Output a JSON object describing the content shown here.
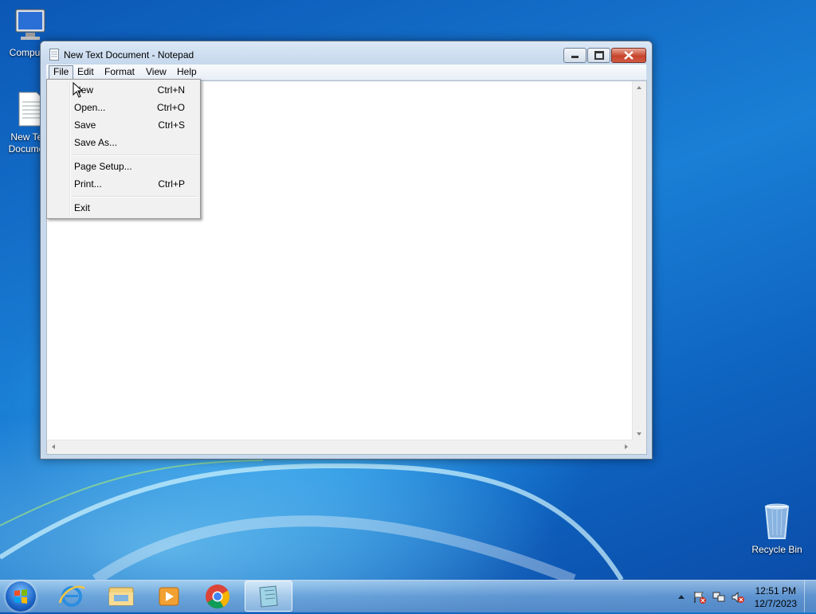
{
  "desktop": {
    "icons": [
      {
        "label": "Computer"
      },
      {
        "label": "New Text Document"
      },
      {
        "label": "Recycle Bin"
      }
    ]
  },
  "window": {
    "title": "New Text Document - Notepad",
    "menu": [
      "File",
      "Edit",
      "Format",
      "View",
      "Help"
    ],
    "active_menu": "File",
    "editor_text": ""
  },
  "file_menu": {
    "items": [
      {
        "label": "New",
        "shortcut": "Ctrl+N"
      },
      {
        "label": "Open...",
        "shortcut": "Ctrl+O"
      },
      {
        "label": "Save",
        "shortcut": "Ctrl+S"
      },
      {
        "label": "Save As...",
        "shortcut": ""
      },
      {
        "label": "Page Setup...",
        "shortcut": ""
      },
      {
        "label": "Print...",
        "shortcut": "Ctrl+P"
      },
      {
        "label": "Exit",
        "shortcut": ""
      }
    ]
  },
  "taskbar": {
    "pinned": [
      {
        "name": "internet-explorer-icon"
      },
      {
        "name": "windows-explorer-icon"
      },
      {
        "name": "media-player-icon"
      },
      {
        "name": "chrome-icon"
      },
      {
        "name": "notepad-icon"
      }
    ],
    "clock": {
      "time": "12:51 PM",
      "date": "12/7/2023"
    }
  },
  "colors": {
    "titlebar": "#c9d9ec",
    "close_button": "#c7442b",
    "desktop": "#1a7fd6"
  }
}
